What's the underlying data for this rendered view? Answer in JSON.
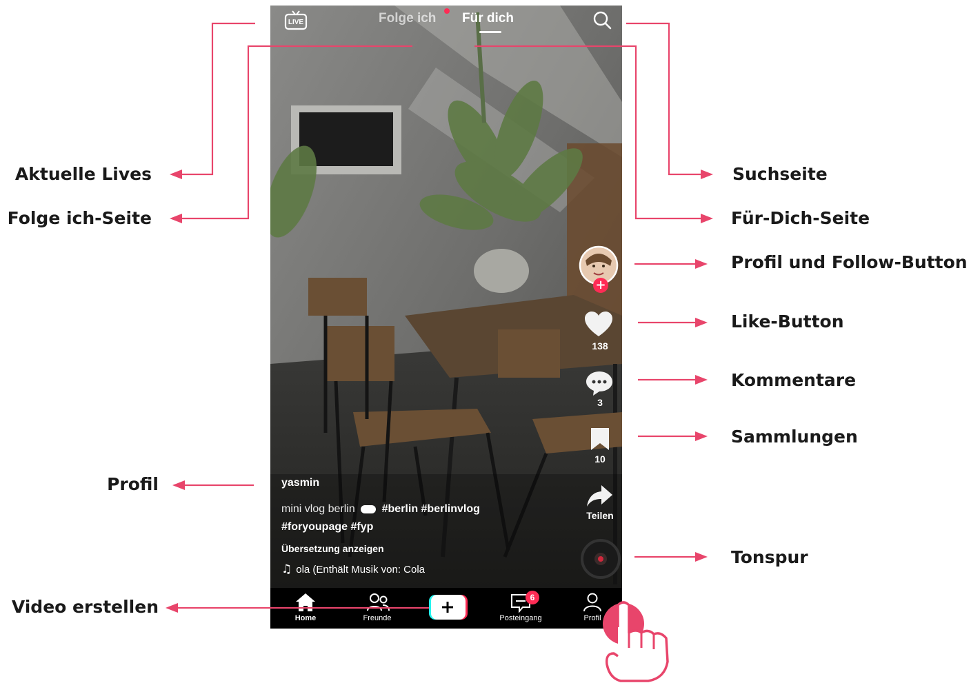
{
  "annotations": {
    "live": "Aktuelle Lives",
    "following": "Folge ich-Seite",
    "profile": "Profil",
    "create": "Video erstellen",
    "search": "Suchseite",
    "foryou": "Für-Dich-Seite",
    "profile_follow": "Profil und Follow-Button",
    "like": "Like-Button",
    "comments": "Kommentare",
    "collections": "Sammlungen",
    "sound": "Tonspur"
  },
  "topbar": {
    "live_icon_text": "LIVE",
    "tab_following": "Folge ich",
    "tab_foryou": "Für dich"
  },
  "side": {
    "likes": "138",
    "comments": "3",
    "saves": "10",
    "share": "Teilen"
  },
  "post": {
    "username": "yasmin",
    "caption_text": "mini vlog berlin",
    "caption_tags1": "#berlin #berlinvlog",
    "caption_tags2": "#foryoupage #fyp",
    "translate": "Übersetzung anzeigen",
    "music": "ola (Enthält Musik von: Cola"
  },
  "nav": {
    "home": "Home",
    "friends": "Freunde",
    "inbox": "Posteingang",
    "inbox_badge": "6",
    "profile": "Profil"
  },
  "colors": {
    "accent": "#e8456b",
    "tiktok_red": "#fe2c55",
    "tiktok_cyan": "#25f4ee"
  }
}
